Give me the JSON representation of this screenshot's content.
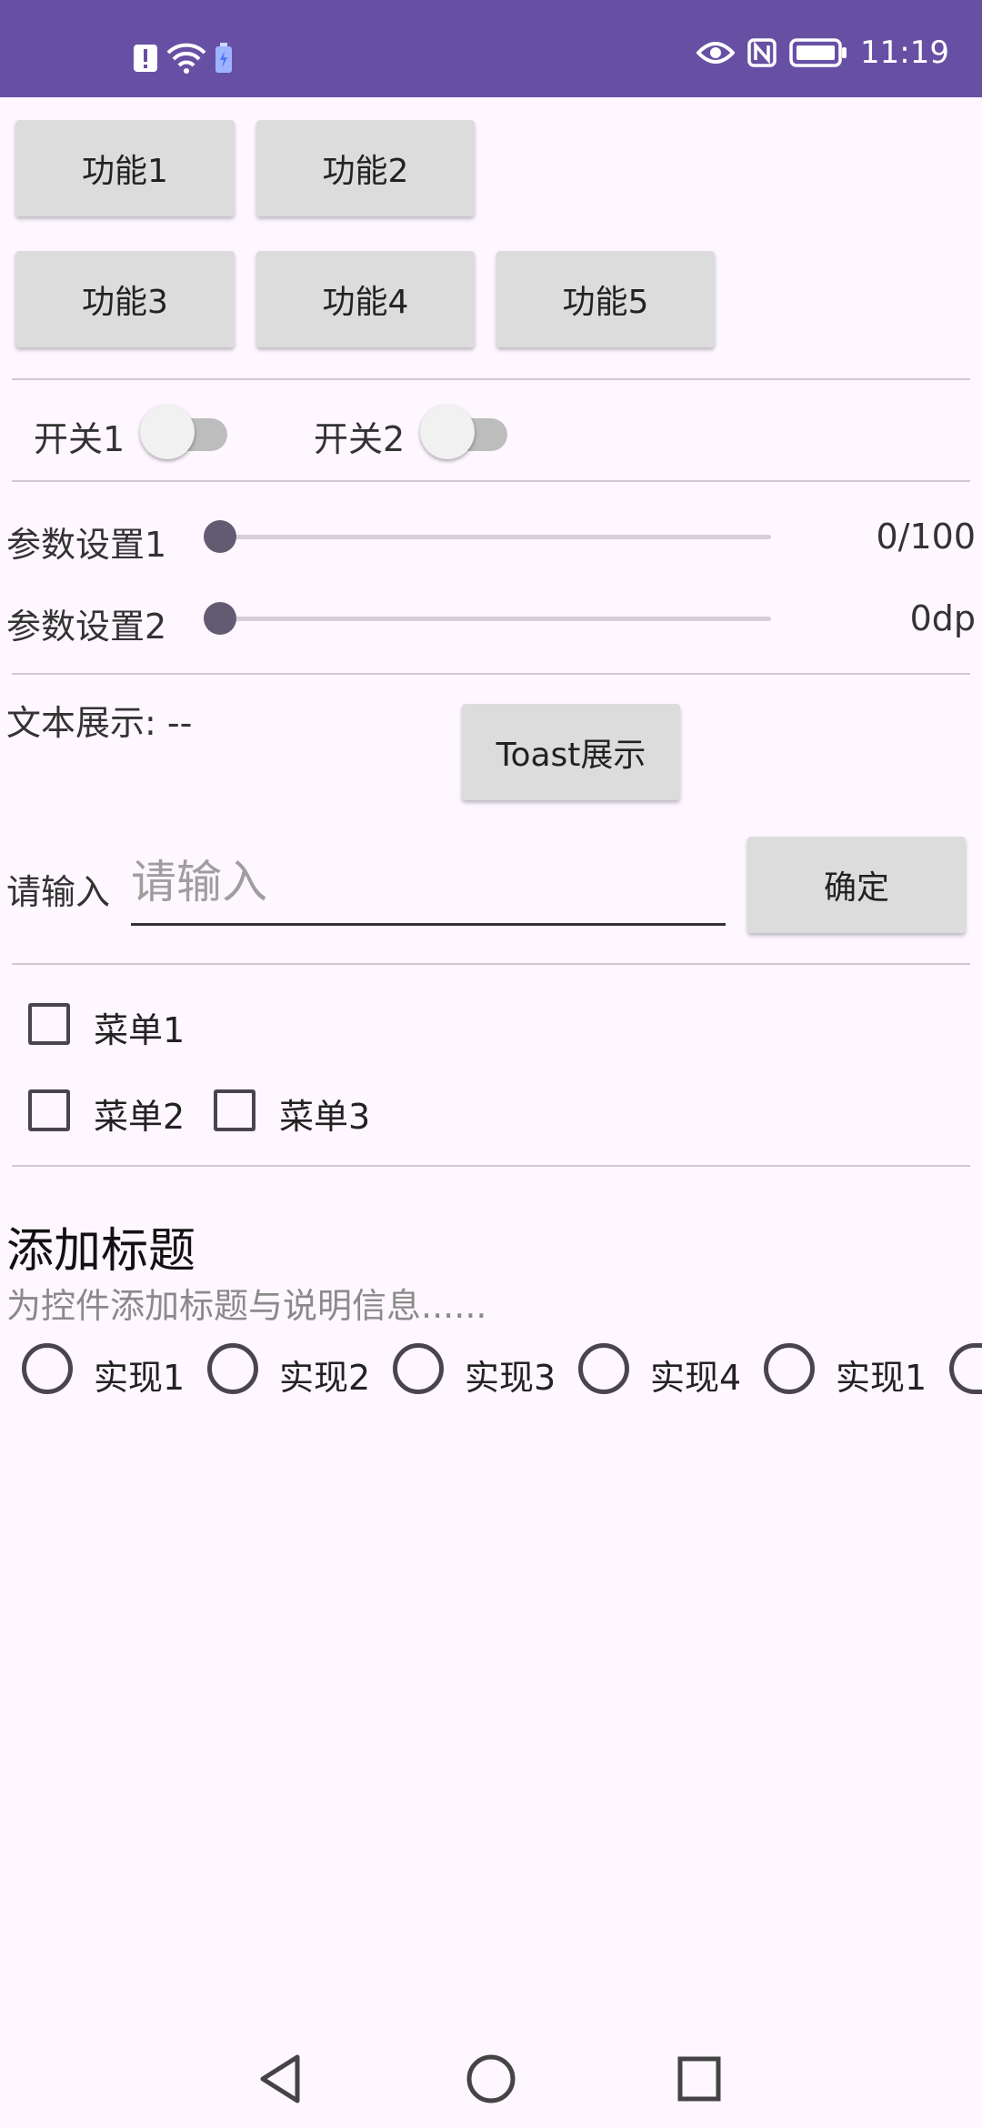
{
  "status_bar": {
    "time": "11:19",
    "left_icons": [
      "alert-icon",
      "wifi-icon",
      "battery-saver-icon"
    ],
    "right_icons": [
      "eye-icon",
      "nfc-icon",
      "battery-icon"
    ],
    "background": "#6750A4"
  },
  "buttons": {
    "row1": [
      "功能1",
      "功能2"
    ],
    "row2": [
      "功能3",
      "功能4",
      "功能5"
    ],
    "toast": "Toast展示",
    "confirm": "确定"
  },
  "switches": [
    {
      "label": "开关1",
      "on": false
    },
    {
      "label": "开关2",
      "on": false
    }
  ],
  "sliders": [
    {
      "label": "参数设置1",
      "value": 0,
      "value_text": "0/100"
    },
    {
      "label": "参数设置2",
      "value": 0,
      "value_text": "0dp"
    }
  ],
  "text_display": {
    "label": "文本展示: --"
  },
  "input": {
    "label": "请输入",
    "placeholder": "请输入",
    "value": ""
  },
  "checkboxes": [
    {
      "label": "菜单1",
      "checked": false
    },
    {
      "label": "菜单2",
      "checked": false
    },
    {
      "label": "菜单3",
      "checked": false
    }
  ],
  "section": {
    "title": "添加标题",
    "subtitle": "为控件添加标题与说明信息......"
  },
  "radios": [
    {
      "label": "实现1",
      "checked": false
    },
    {
      "label": "实现2",
      "checked": false
    },
    {
      "label": "实现3",
      "checked": false
    },
    {
      "label": "实现4",
      "checked": false
    },
    {
      "label": "实现1",
      "checked": false
    }
  ],
  "nav_bar": {
    "icons": [
      "back-triangle-icon",
      "home-circle-icon",
      "recents-square-icon"
    ]
  }
}
